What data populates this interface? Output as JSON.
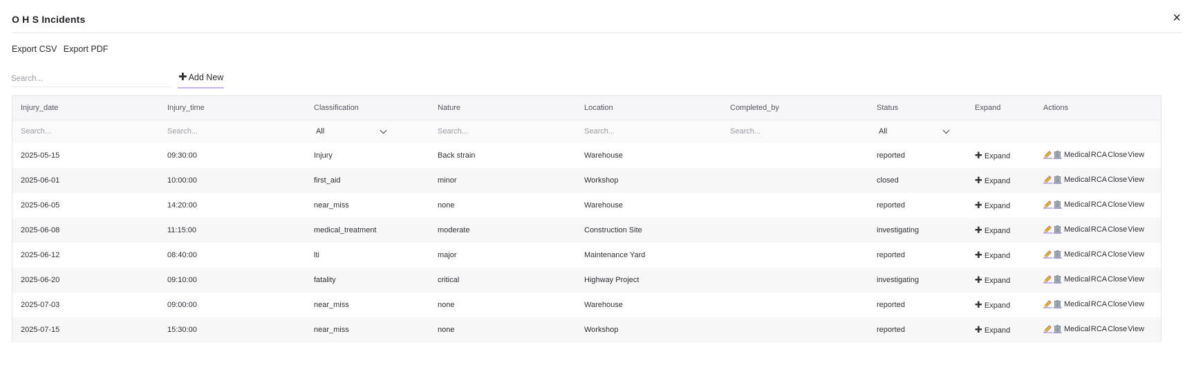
{
  "modal": {
    "title": "O H S Incidents",
    "close_label": "×"
  },
  "exports": {
    "csv_label": "Export CSV",
    "pdf_label": "Export PDF"
  },
  "search": {
    "placeholder": "Search..."
  },
  "add_new": {
    "label": "Add New",
    "icon": "plus-icon"
  },
  "table": {
    "columns": [
      "Injury_date",
      "Injury_time",
      "Classification",
      "Nature",
      "Location",
      "Completed_by",
      "Status",
      "Expand",
      "Actions"
    ],
    "filters": {
      "injury_date_placeholder": "Search...",
      "injury_time_placeholder": "Search...",
      "classification_value": "All",
      "nature_placeholder": "Search...",
      "location_placeholder": "Search...",
      "completed_by_placeholder": "Search...",
      "status_value": "All"
    },
    "expand_label": "Expand",
    "action_links": [
      "Medical",
      "RCA",
      "Close",
      "View"
    ],
    "action_icons": [
      "pencil-icon",
      "trash-icon"
    ],
    "rows": [
      {
        "injury_date": "2025-05-15",
        "injury_time": "09:30:00",
        "classification": "Injury",
        "nature": "Back strain",
        "location": "Warehouse",
        "completed_by": "",
        "status": "reported"
      },
      {
        "injury_date": "2025-06-01",
        "injury_time": "10:00:00",
        "classification": "first_aid",
        "nature": "minor",
        "location": "Workshop",
        "completed_by": "",
        "status": "closed"
      },
      {
        "injury_date": "2025-06-05",
        "injury_time": "14:20:00",
        "classification": "near_miss",
        "nature": "none",
        "location": "Warehouse",
        "completed_by": "",
        "status": "reported"
      },
      {
        "injury_date": "2025-06-08",
        "injury_time": "11:15:00",
        "classification": "medical_treatment",
        "nature": "moderate",
        "location": "Construction Site",
        "completed_by": "",
        "status": "investigating"
      },
      {
        "injury_date": "2025-06-12",
        "injury_time": "08:40:00",
        "classification": "lti",
        "nature": "major",
        "location": "Maintenance Yard",
        "completed_by": "",
        "status": "reported"
      },
      {
        "injury_date": "2025-06-20",
        "injury_time": "09:10:00",
        "classification": "fatality",
        "nature": "critical",
        "location": "Highway Project",
        "completed_by": "",
        "status": "investigating"
      },
      {
        "injury_date": "2025-07-03",
        "injury_time": "09:00:00",
        "classification": "near_miss",
        "nature": "none",
        "location": "Warehouse",
        "completed_by": "",
        "status": "reported"
      },
      {
        "injury_date": "2025-07-15",
        "injury_time": "15:30:00",
        "classification": "near_miss",
        "nature": "none",
        "location": "Workshop",
        "completed_by": "",
        "status": "reported"
      }
    ]
  },
  "colors": {
    "accent_underline": "#c9b5f4",
    "header_bg": "#f6f6f8",
    "stripe_bg": "#f7f7f8"
  }
}
